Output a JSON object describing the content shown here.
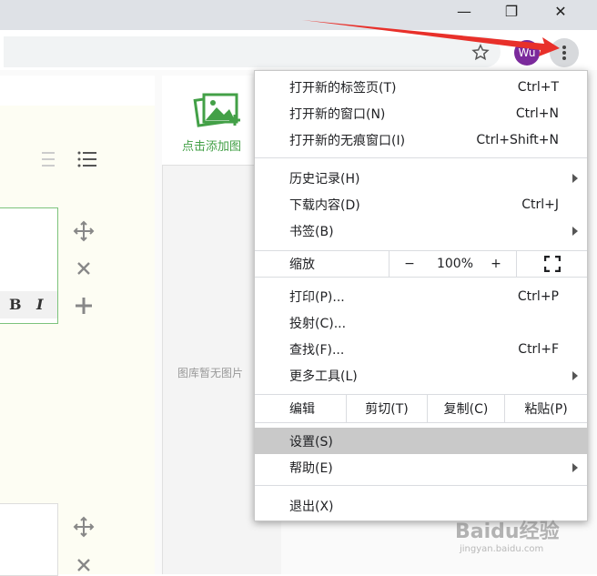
{
  "window": {
    "minimize": "—",
    "maximize": "❐",
    "close": "✕"
  },
  "toolbar": {
    "avatar_initials": "Wu"
  },
  "page": {
    "add_image": "点击添加图",
    "empty_gallery": "图库暂无图片"
  },
  "menu": {
    "new_tab": {
      "label": "打开新的标签页(T)",
      "shortcut": "Ctrl+T"
    },
    "new_window": {
      "label": "打开新的窗口(N)",
      "shortcut": "Ctrl+N"
    },
    "new_incognito": {
      "label": "打开新的无痕窗口(I)",
      "shortcut": "Ctrl+Shift+N"
    },
    "history": {
      "label": "历史记录(H)"
    },
    "downloads": {
      "label": "下载内容(D)",
      "shortcut": "Ctrl+J"
    },
    "bookmarks": {
      "label": "书签(B)"
    },
    "zoom": {
      "label": "缩放",
      "minus": "−",
      "value": "100%",
      "plus": "+"
    },
    "print": {
      "label": "打印(P)...",
      "shortcut": "Ctrl+P"
    },
    "cast": {
      "label": "投射(C)..."
    },
    "find": {
      "label": "查找(F)...",
      "shortcut": "Ctrl+F"
    },
    "more_tools": {
      "label": "更多工具(L)"
    },
    "edit": {
      "label": "编辑",
      "cut": "剪切(T)",
      "copy": "复制(C)",
      "paste": "粘贴(P)"
    },
    "settings": {
      "label": "设置(S)"
    },
    "help": {
      "label": "帮助(E)"
    },
    "exit": {
      "label": "退出(X)"
    }
  },
  "watermark": {
    "brand": "Baidu经验",
    "url": "jingyan.baidu.com"
  },
  "colors": {
    "arrow": "#e8302a",
    "accent_green": "#43a047",
    "highlight": "#c9c9c9"
  }
}
